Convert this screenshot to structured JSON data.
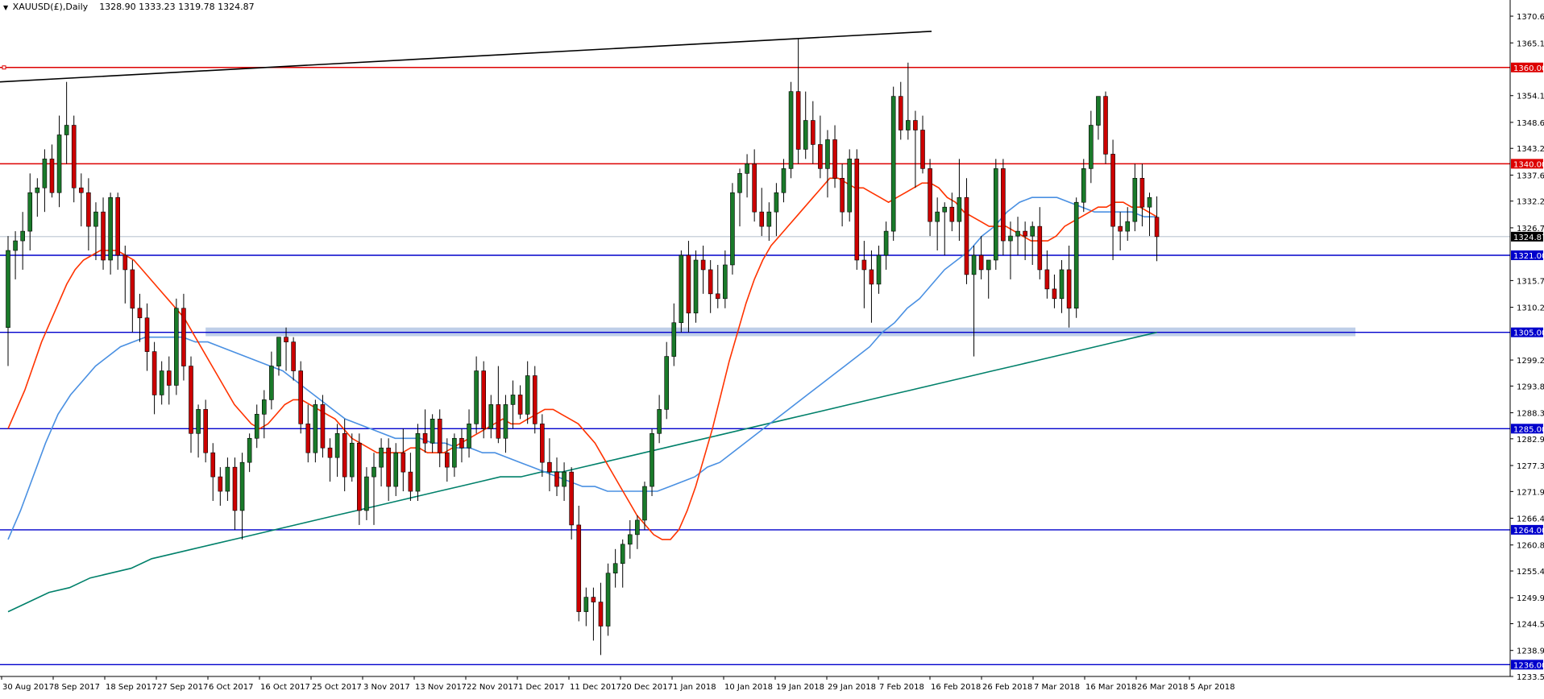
{
  "header": {
    "symbol": "XAUUSD(£),Daily",
    "ohlc": "1328.90 1333.23 1319.78 1324.87"
  },
  "colors": {
    "bull_candle": "#1a7a2a",
    "bear_candle": "#cc0000",
    "support_line": "#0000cc",
    "resistance_line": "#dd0000",
    "ma_fast": "#ff3300",
    "ma_medium": "#4a90e2",
    "ma_slow": "#00806a",
    "support_zone": "#a8bde0",
    "trendline": "#000000"
  },
  "chart_data": {
    "type": "candlestick",
    "title": "XAUUSD(£),Daily",
    "ylim": [
      1233.55,
      1372.5
    ],
    "grid": false,
    "last_price": "1324.87",
    "x_ticks": [
      "30 Aug 2017",
      "8 Sep 2017",
      "18 Sep 2017",
      "27 Sep 2017",
      "6 Oct 2017",
      "16 Oct 2017",
      "25 Oct 2017",
      "3 Nov 2017",
      "13 Nov 2017",
      "22 Nov 2017",
      "1 Dec 2017",
      "11 Dec 2017",
      "20 Dec 2017",
      "1 Jan 2018",
      "10 Jan 2018",
      "19 Jan 2018",
      "29 Jan 2018",
      "7 Feb 2018",
      "16 Feb 2018",
      "26 Feb 2018",
      "7 Mar 2018",
      "16 Mar 2018",
      "26 Mar 2018",
      "5 Apr 2018"
    ],
    "y_ticks": [
      "1370.65",
      "1365.10",
      "1354.15",
      "1348.60",
      "1343.20",
      "1337.65",
      "1332.25",
      "1326.70",
      "1315.75",
      "1310.20",
      "1299.25",
      "1293.85",
      "1288.30",
      "1282.90",
      "1277.35",
      "1271.95",
      "1266.40",
      "1260.85",
      "1255.45",
      "1249.90",
      "1244.50",
      "1238.95",
      "1233.55"
    ],
    "horizontal_levels": [
      {
        "label": "1360.00",
        "value": 1360.0,
        "role": "resistance"
      },
      {
        "label": "1340.00",
        "value": 1340.0,
        "role": "resistance"
      },
      {
        "label": "1321.00",
        "value": 1321.0,
        "role": "support"
      },
      {
        "label": "1305.00",
        "value": 1305.0,
        "role": "support"
      },
      {
        "label": "1285.00",
        "value": 1285.0,
        "role": "support"
      },
      {
        "label": "1264.00",
        "value": 1264.0,
        "role": "support"
      },
      {
        "label": "1236.00",
        "value": 1236.0,
        "role": "support"
      }
    ],
    "support_zone": {
      "from": 1304.2,
      "to": 1306.0
    },
    "trendline": {
      "from": {
        "i": 0,
        "v": 1357.0
      },
      "to": {
        "i": 147,
        "v": 1367.5
      }
    },
    "candles_ohlc": [
      [
        1306,
        1325,
        1298,
        1322
      ],
      [
        1322,
        1326,
        1316,
        1324
      ],
      [
        1324,
        1330,
        1318,
        1326
      ],
      [
        1326,
        1338,
        1322,
        1334
      ],
      [
        1334,
        1337,
        1329,
        1335
      ],
      [
        1335,
        1343,
        1330,
        1341
      ],
      [
        1341,
        1344,
        1333,
        1334
      ],
      [
        1334,
        1350,
        1331,
        1346
      ],
      [
        1346,
        1357,
        1340,
        1348
      ],
      [
        1348,
        1350,
        1332,
        1335
      ],
      [
        1335,
        1338,
        1327,
        1334
      ],
      [
        1334,
        1337,
        1322,
        1327
      ],
      [
        1327,
        1332,
        1320,
        1330
      ],
      [
        1330,
        1333,
        1318,
        1320
      ],
      [
        1320,
        1334,
        1317,
        1333
      ],
      [
        1333,
        1334,
        1318,
        1321
      ],
      [
        1321,
        1323,
        1311,
        1318
      ],
      [
        1318,
        1320,
        1305,
        1310
      ],
      [
        1310,
        1313,
        1303,
        1308
      ],
      [
        1308,
        1311,
        1297,
        1301
      ],
      [
        1301,
        1303,
        1288,
        1292
      ],
      [
        1292,
        1299,
        1290,
        1297
      ],
      [
        1297,
        1300,
        1290,
        1294
      ],
      [
        1294,
        1312,
        1292,
        1310
      ],
      [
        1310,
        1313,
        1295,
        1298
      ],
      [
        1298,
        1300,
        1280,
        1284
      ],
      [
        1284,
        1290,
        1279,
        1289
      ],
      [
        1289,
        1291,
        1278,
        1280
      ],
      [
        1280,
        1282,
        1270,
        1275
      ],
      [
        1275,
        1277,
        1269,
        1272
      ],
      [
        1272,
        1279,
        1270,
        1277
      ],
      [
        1277,
        1279,
        1264,
        1268
      ],
      [
        1268,
        1280,
        1262,
        1278
      ],
      [
        1278,
        1284,
        1276,
        1283
      ],
      [
        1283,
        1290,
        1281,
        1288
      ],
      [
        1288,
        1293,
        1283,
        1291
      ],
      [
        1291,
        1301,
        1289,
        1298
      ],
      [
        1298,
        1304,
        1296,
        1304
      ],
      [
        1304,
        1306,
        1297,
        1303
      ],
      [
        1303,
        1304,
        1295,
        1297
      ],
      [
        1297,
        1299,
        1284,
        1286
      ],
      [
        1286,
        1290,
        1278,
        1280
      ],
      [
        1280,
        1291,
        1278,
        1290
      ],
      [
        1290,
        1292,
        1279,
        1281
      ],
      [
        1281,
        1283,
        1274,
        1279
      ],
      [
        1279,
        1286,
        1275,
        1284
      ],
      [
        1284,
        1287,
        1272,
        1275
      ],
      [
        1275,
        1284,
        1274,
        1282
      ],
      [
        1282,
        1284,
        1265,
        1268
      ],
      [
        1268,
        1277,
        1266,
        1275
      ],
      [
        1275,
        1280,
        1265,
        1277
      ],
      [
        1277,
        1283,
        1273,
        1281
      ],
      [
        1281,
        1283,
        1270,
        1273
      ],
      [
        1273,
        1282,
        1271,
        1280
      ],
      [
        1280,
        1285,
        1272,
        1276
      ],
      [
        1276,
        1280,
        1270,
        1272
      ],
      [
        1272,
        1286,
        1270,
        1284
      ],
      [
        1284,
        1289,
        1280,
        1282
      ],
      [
        1282,
        1288,
        1280,
        1287
      ],
      [
        1287,
        1289,
        1277,
        1280
      ],
      [
        1280,
        1283,
        1274,
        1277
      ],
      [
        1277,
        1284,
        1275,
        1283
      ],
      [
        1283,
        1285,
        1278,
        1281
      ],
      [
        1281,
        1289,
        1279,
        1286
      ],
      [
        1286,
        1300,
        1284,
        1297
      ],
      [
        1297,
        1299,
        1283,
        1285
      ],
      [
        1285,
        1292,
        1283,
        1290
      ],
      [
        1290,
        1298,
        1282,
        1283
      ],
      [
        1283,
        1292,
        1280,
        1290
      ],
      [
        1290,
        1295,
        1285,
        1292
      ],
      [
        1292,
        1294,
        1287,
        1288
      ],
      [
        1288,
        1299,
        1286,
        1296
      ],
      [
        1296,
        1298,
        1284,
        1286
      ],
      [
        1286,
        1288,
        1275,
        1278
      ],
      [
        1278,
        1283,
        1272,
        1276
      ],
      [
        1276,
        1279,
        1271,
        1273
      ],
      [
        1273,
        1278,
        1270,
        1276
      ],
      [
        1276,
        1277,
        1262,
        1265
      ],
      [
        1265,
        1269,
        1245,
        1247
      ],
      [
        1247,
        1252,
        1244,
        1250
      ],
      [
        1250,
        1252,
        1241,
        1249
      ],
      [
        1249,
        1253,
        1238,
        1244
      ],
      [
        1244,
        1257,
        1242,
        1255
      ],
      [
        1255,
        1260,
        1252,
        1257
      ],
      [
        1257,
        1262,
        1252,
        1261
      ],
      [
        1261,
        1266,
        1258,
        1263
      ],
      [
        1263,
        1267,
        1260,
        1266
      ],
      [
        1266,
        1274,
        1264,
        1273
      ],
      [
        1273,
        1285,
        1271,
        1284
      ],
      [
        1284,
        1292,
        1282,
        1289
      ],
      [
        1289,
        1303,
        1287,
        1300
      ],
      [
        1300,
        1311,
        1298,
        1307
      ],
      [
        1307,
        1322,
        1305,
        1321
      ],
      [
        1321,
        1324,
        1305,
        1309
      ],
      [
        1309,
        1322,
        1307,
        1320
      ],
      [
        1320,
        1323,
        1313,
        1318
      ],
      [
        1318,
        1320,
        1309,
        1313
      ],
      [
        1313,
        1319,
        1310,
        1312
      ],
      [
        1312,
        1322,
        1310,
        1319
      ],
      [
        1319,
        1336,
        1317,
        1334
      ],
      [
        1334,
        1339,
        1327,
        1338
      ],
      [
        1338,
        1342,
        1333,
        1340
      ],
      [
        1340,
        1343,
        1328,
        1330
      ],
      [
        1330,
        1335,
        1325,
        1327
      ],
      [
        1327,
        1332,
        1324,
        1330
      ],
      [
        1330,
        1336,
        1325,
        1334
      ],
      [
        1334,
        1341,
        1332,
        1339
      ],
      [
        1339,
        1357,
        1337,
        1355
      ],
      [
        1355,
        1366,
        1340,
        1343
      ],
      [
        1343,
        1355,
        1341,
        1349
      ],
      [
        1349,
        1353,
        1340,
        1344
      ],
      [
        1344,
        1350,
        1337,
        1339
      ],
      [
        1339,
        1347,
        1333,
        1345
      ],
      [
        1345,
        1348,
        1335,
        1337
      ],
      [
        1337,
        1340,
        1327,
        1330
      ],
      [
        1330,
        1343,
        1328,
        1341
      ],
      [
        1341,
        1343,
        1318,
        1320
      ],
      [
        1320,
        1324,
        1310,
        1318
      ],
      [
        1318,
        1322,
        1307,
        1315
      ],
      [
        1315,
        1323,
        1313,
        1321
      ],
      [
        1321,
        1328,
        1318,
        1326
      ],
      [
        1326,
        1356,
        1324,
        1354
      ],
      [
        1354,
        1357,
        1345,
        1347
      ],
      [
        1347,
        1361,
        1345,
        1349
      ],
      [
        1349,
        1351,
        1335,
        1347
      ],
      [
        1347,
        1350,
        1338,
        1339
      ],
      [
        1339,
        1341,
        1325,
        1328
      ],
      [
        1328,
        1333,
        1322,
        1330
      ],
      [
        1330,
        1332,
        1321,
        1331
      ],
      [
        1331,
        1334,
        1326,
        1328
      ],
      [
        1328,
        1341,
        1324,
        1333
      ],
      [
        1333,
        1337,
        1315,
        1317
      ],
      [
        1317,
        1323,
        1300,
        1321
      ],
      [
        1321,
        1325,
        1316,
        1318
      ],
      [
        1318,
        1320,
        1312,
        1320
      ],
      [
        1320,
        1341,
        1318,
        1339
      ],
      [
        1339,
        1341,
        1321,
        1324
      ],
      [
        1324,
        1328,
        1316,
        1325
      ],
      [
        1325,
        1329,
        1321,
        1326
      ],
      [
        1326,
        1328,
        1320,
        1325
      ],
      [
        1325,
        1328,
        1319,
        1327
      ],
      [
        1327,
        1331,
        1316,
        1318
      ],
      [
        1318,
        1322,
        1312,
        1314
      ],
      [
        1314,
        1317,
        1310,
        1312
      ],
      [
        1312,
        1320,
        1309,
        1318
      ],
      [
        1318,
        1323,
        1306,
        1310
      ],
      [
        1310,
        1333,
        1308,
        1332
      ],
      [
        1332,
        1341,
        1330,
        1339
      ],
      [
        1339,
        1351,
        1336,
        1348
      ],
      [
        1348,
        1354,
        1345,
        1354
      ],
      [
        1354,
        1355,
        1340,
        1342
      ],
      [
        1342,
        1345,
        1320,
        1327
      ],
      [
        1327,
        1330,
        1322,
        1326
      ],
      [
        1326,
        1331,
        1324,
        1328
      ],
      [
        1328,
        1340,
        1326,
        1337
      ],
      [
        1337,
        1340,
        1327,
        1331
      ],
      [
        1331,
        1334,
        1325,
        1333
      ],
      [
        1328.9,
        1333.23,
        1319.78,
        1324.87
      ]
    ],
    "ma_fast_values": [
      1285,
      1289,
      1293,
      1298,
      1303,
      1307,
      1311,
      1315,
      1318,
      1320,
      1321,
      1322,
      1322,
      1322,
      1321,
      1320,
      1318,
      1316,
      1314,
      1312,
      1310,
      1308,
      1305,
      1302,
      1299,
      1296,
      1293,
      1290,
      1288,
      1286,
      1285,
      1286,
      1288,
      1290,
      1291,
      1291,
      1290,
      1289,
      1288,
      1287,
      1285,
      1283,
      1282,
      1281,
      1280,
      1280,
      1280,
      1280,
      1281,
      1281,
      1280,
      1280,
      1280,
      1281,
      1282,
      1283,
      1284,
      1285,
      1286,
      1287,
      1286,
      1286,
      1287,
      1288,
      1289,
      1289,
      1288,
      1287,
      1286,
      1284,
      1282,
      1279,
      1276,
      1273,
      1270,
      1267,
      1265,
      1263,
      1262,
      1262,
      1264,
      1268,
      1273,
      1279,
      1285,
      1292,
      1299,
      1305,
      1311,
      1316,
      1320,
      1323,
      1325,
      1327,
      1329,
      1331,
      1333,
      1335,
      1337,
      1337,
      1336,
      1335,
      1335,
      1334,
      1333,
      1332,
      1333,
      1334,
      1335,
      1336,
      1336,
      1335,
      1333,
      1332,
      1330,
      1329,
      1328,
      1327,
      1327,
      1327,
      1326,
      1325,
      1324,
      1324,
      1324,
      1325,
      1327,
      1328,
      1329,
      1330,
      1331,
      1331,
      1332,
      1332,
      1331,
      1331,
      1330,
      1329
    ],
    "ma_medium_values": [
      1262,
      1268,
      1275,
      1282,
      1288,
      1292,
      1295,
      1298,
      1300,
      1302,
      1303,
      1304,
      1304,
      1304,
      1304,
      1303,
      1303,
      1302,
      1301,
      1300,
      1299,
      1298,
      1297,
      1295,
      1293,
      1291,
      1289,
      1287,
      1286,
      1285,
      1284,
      1283,
      1283,
      1283,
      1282,
      1282,
      1281,
      1281,
      1280,
      1280,
      1279,
      1278,
      1277,
      1276,
      1275,
      1274,
      1273,
      1273,
      1272,
      1272,
      1272,
      1272,
      1272,
      1273,
      1274,
      1275,
      1277,
      1278,
      1280,
      1282,
      1284,
      1286,
      1288,
      1290,
      1292,
      1294,
      1296,
      1298,
      1300,
      1302,
      1305,
      1307,
      1310,
      1312,
      1315,
      1318,
      1320,
      1322,
      1325,
      1327,
      1330,
      1332,
      1333,
      1333,
      1333,
      1332,
      1331,
      1330,
      1330,
      1330,
      1330,
      1329,
      1329
    ],
    "ma_slow_values": [
      1247,
      1249,
      1251,
      1252,
      1254,
      1255,
      1256,
      1258,
      1259,
      1260,
      1261,
      1262,
      1263,
      1264,
      1265,
      1266,
      1267,
      1268,
      1269,
      1270,
      1271,
      1272,
      1273,
      1274,
      1275,
      1275,
      1276,
      1276,
      1277,
      1278,
      1279,
      1280,
      1281,
      1282,
      1283,
      1284,
      1285,
      1286,
      1287,
      1288,
      1289,
      1290,
      1291,
      1292,
      1293,
      1294,
      1295,
      1296,
      1297,
      1298,
      1299,
      1300,
      1301,
      1302,
      1303,
      1304,
      1305
    ]
  }
}
